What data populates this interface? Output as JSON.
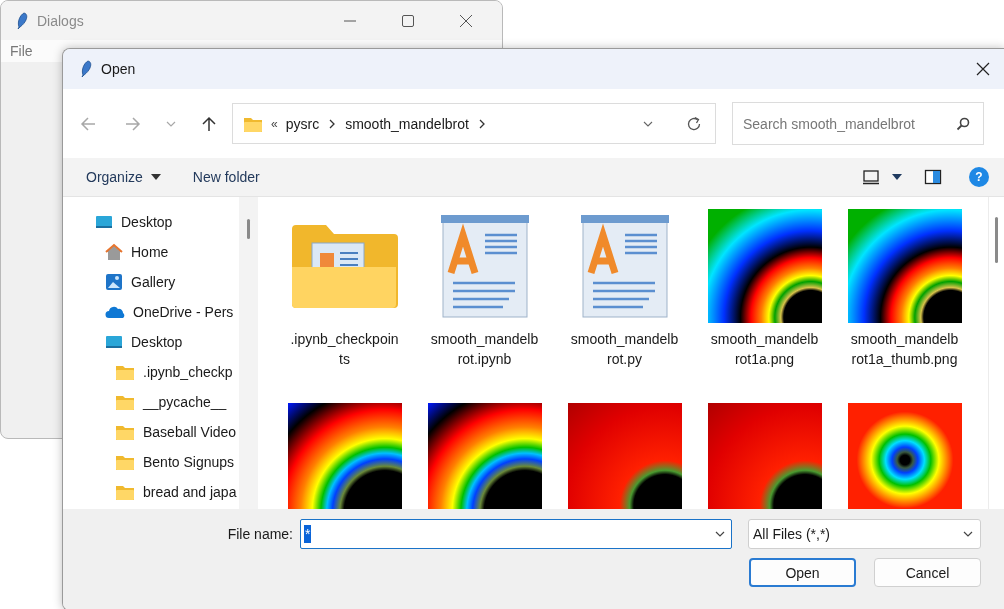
{
  "background_window": {
    "title": "Dialogs",
    "menu": [
      "File"
    ]
  },
  "dialog": {
    "title": "Open",
    "nav_buttons": [
      {
        "kind": "back",
        "disabled": true
      },
      {
        "kind": "forward",
        "disabled": true
      },
      {
        "kind": "recent",
        "disabled": true
      },
      {
        "kind": "up",
        "disabled": false
      }
    ],
    "address": {
      "overflow": "«",
      "segments": [
        "pysrc",
        "smooth_mandelbrot"
      ]
    },
    "search": {
      "placeholder": "Search smooth_mandelbrot"
    },
    "commands": [
      {
        "label": "Organize",
        "dropdown": true
      },
      {
        "label": "New folder",
        "dropdown": false
      }
    ],
    "help": "?",
    "sidebar": {
      "items": [
        {
          "label": "Desktop",
          "kind": "desktop",
          "children": [
            {
              "label": "Home",
              "kind": "home"
            },
            {
              "label": "Gallery",
              "kind": "gallery"
            },
            {
              "label": "OneDrive - Pers",
              "kind": "onedrive"
            },
            {
              "label": "Desktop",
              "kind": "desktop",
              "children": [
                {
                  "label": ".ipynb_checkp",
                  "kind": "folder"
                },
                {
                  "label": "__pycache__",
                  "kind": "folder"
                },
                {
                  "label": "Baseball Video",
                  "kind": "folder"
                },
                {
                  "label": "Bento Signups",
                  "kind": "folder"
                },
                {
                  "label": "bread and japa",
                  "kind": "folder"
                }
              ]
            }
          ]
        }
      ]
    },
    "files": [
      {
        "kind": "folder",
        "name": ".ipynb_checkpoints"
      },
      {
        "kind": "document",
        "name": "smooth_mandelbrot.ipynb"
      },
      {
        "kind": "document",
        "name": "smooth_mandelbrot.py"
      },
      {
        "kind": "banded_image",
        "name": "smooth_mandelbrot1a.png"
      },
      {
        "kind": "banded_image",
        "name": "smooth_mandelbrot1a_thumb.png"
      },
      {
        "kind": "smooth_image"
      },
      {
        "kind": "smooth_image"
      },
      {
        "kind": "red_image"
      },
      {
        "kind": "red_image"
      },
      {
        "kind": "cross_image"
      }
    ],
    "file_name": {
      "label": "File name:",
      "value": "*",
      "value_selected": true
    },
    "file_type": {
      "value": "All Files (*,*)"
    },
    "buttons": [
      {
        "label": "Open",
        "default": true
      },
      {
        "label": "Cancel",
        "default": false
      }
    ]
  }
}
